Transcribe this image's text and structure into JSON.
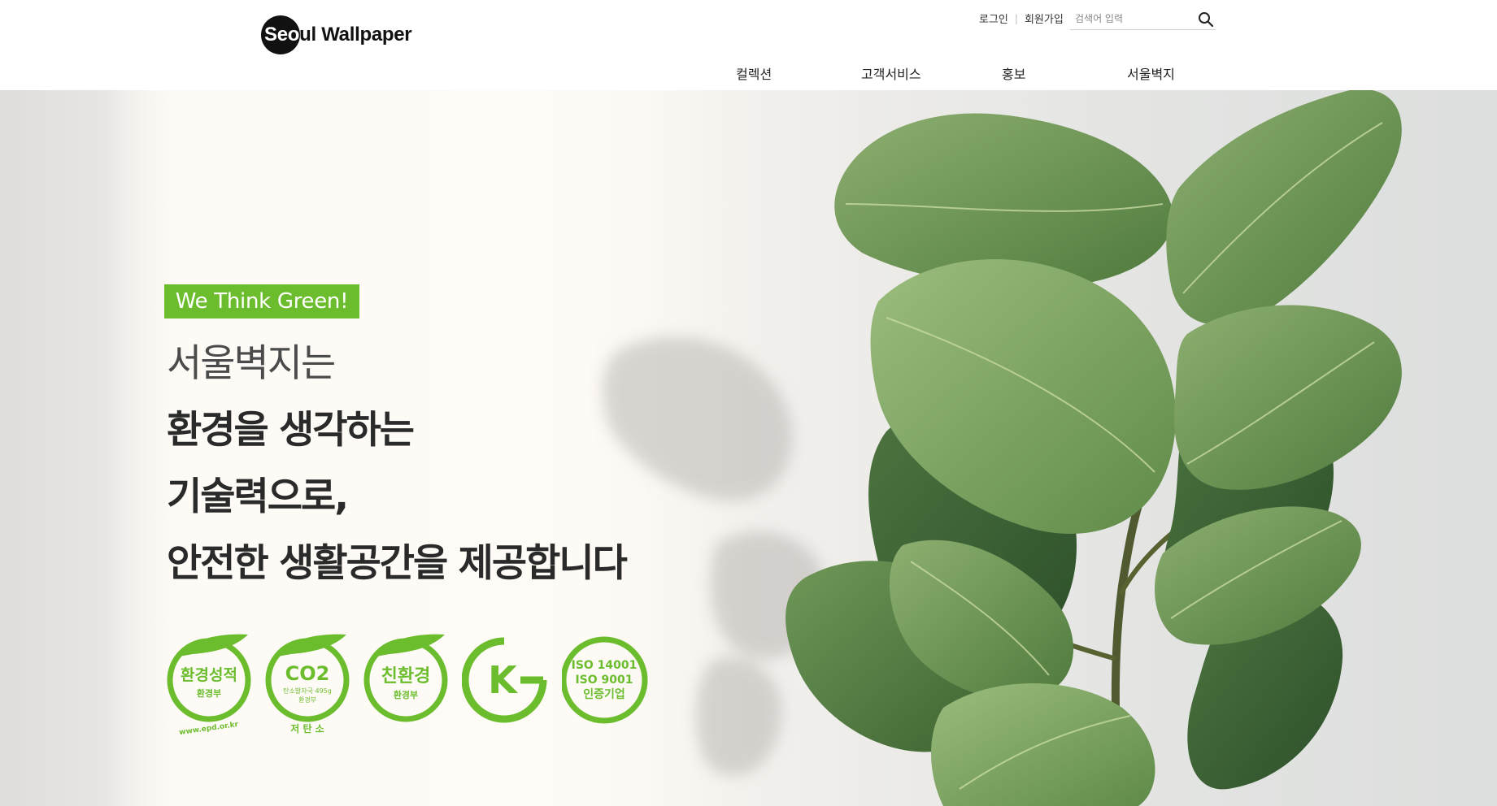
{
  "header": {
    "logo": {
      "part_on_circle": "Seo",
      "part_after": "ul Wallpaper"
    },
    "util_links": {
      "login": "로그인",
      "join": "회원가입",
      "separator": "|"
    },
    "search": {
      "placeholder": "검색어 입력",
      "value": "",
      "icon": "search-icon"
    },
    "nav": [
      {
        "label": "컬렉션"
      },
      {
        "label": "고객서비스"
      },
      {
        "label": "홍보"
      },
      {
        "label": "서울벽지"
      }
    ]
  },
  "hero": {
    "tagline": "We Think Green!",
    "headline": [
      "서울벽지는",
      "환경을 생각하는",
      "기술력으로,",
      "안전한 생활공간을 제공합니다"
    ],
    "badges": [
      {
        "icon": "eco-performance-badge-icon",
        "main": "환경성적",
        "sub": "환경부",
        "arc": "www.epd.or.kr"
      },
      {
        "icon": "low-carbon-badge-icon",
        "main": "CO2",
        "sub": "탄소발자국 495g",
        "sub2": "환경부",
        "arc": "저 탄 소"
      },
      {
        "icon": "eco-friendly-badge-icon",
        "main": "친환경",
        "sub": "환경부"
      },
      {
        "icon": "ks-mark-icon",
        "main": "K"
      },
      {
        "icon": "iso-certification-badge-icon",
        "line1": "ISO 14001",
        "line2": "ISO  9001",
        "line3": "인증기업"
      }
    ]
  },
  "colors": {
    "accent_green": "#6cbd2e",
    "header_bg": "#ffffff",
    "text_dark": "#222222",
    "logo_black": "#111111"
  }
}
